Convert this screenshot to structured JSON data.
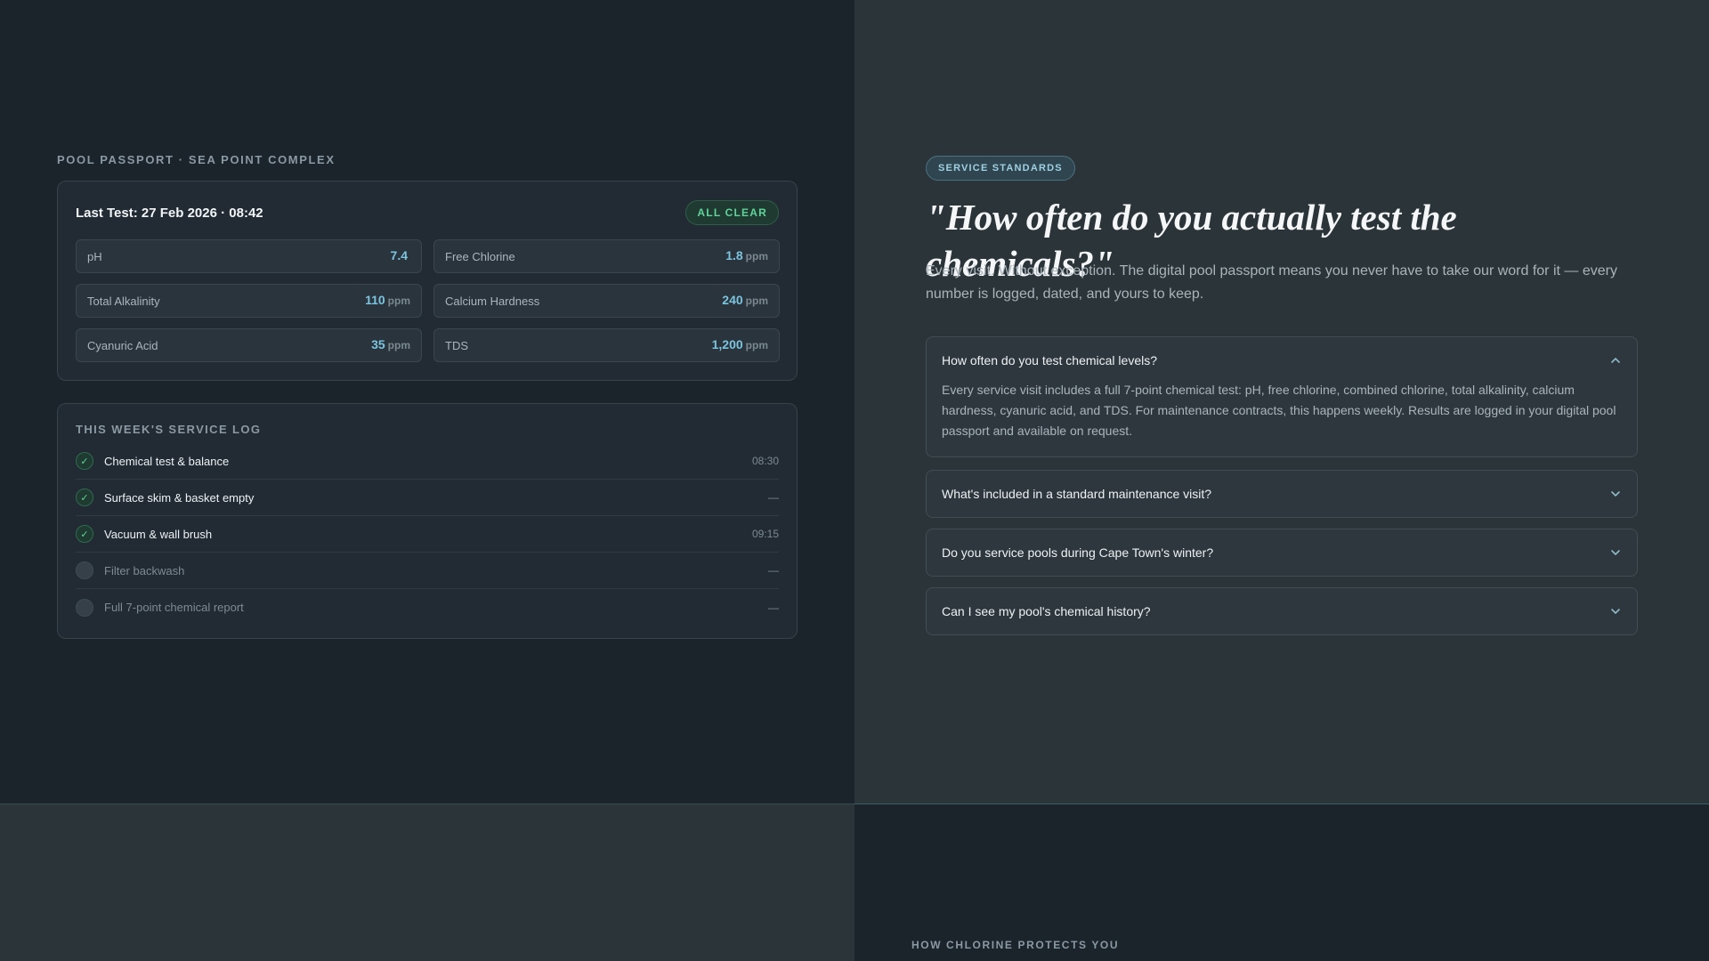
{
  "passport": {
    "eyebrow": "Pool Passport · Sea Point Complex",
    "last_test": "Last Test: 27 Feb 2026 · 08:42",
    "status_badge": "All Clear",
    "metrics": [
      {
        "name": "pH",
        "value": "7.4",
        "unit": ""
      },
      {
        "name": "Free Chlorine",
        "value": "1.8",
        "unit": "ppm"
      },
      {
        "name": "Total Alkalinity",
        "value": "110",
        "unit": "ppm"
      },
      {
        "name": "Calcium Hardness",
        "value": "240",
        "unit": "ppm"
      },
      {
        "name": "Cyanuric Acid",
        "value": "35",
        "unit": "ppm"
      },
      {
        "name": "TDS",
        "value": "1,200",
        "unit": "ppm"
      }
    ]
  },
  "service_log": {
    "title": "This Week's Service Log",
    "items": [
      {
        "label": "Chemical test & balance",
        "time": "08:30",
        "done": true,
        "check": "✓"
      },
      {
        "label": "Surface skim & basket empty",
        "time": "—",
        "done": true,
        "check": "✓"
      },
      {
        "label": "Vacuum & wall brush",
        "time": "09:15",
        "done": true,
        "check": "✓"
      },
      {
        "label": "Filter backwash",
        "time": "—",
        "done": false,
        "check": ""
      },
      {
        "label": "Full 7-point chemical report",
        "time": "—",
        "done": false,
        "check": ""
      }
    ]
  },
  "standards": {
    "tag": "Service Standards",
    "quote": "\"How often do you actually test the chemicals?\"",
    "lede": "Every visit. Without exception. The digital pool passport means you never have to take our word for it — every number is logged, dated, and yours to keep."
  },
  "faq": [
    {
      "question": "How often do you test chemical levels?",
      "answer": "Every service visit includes a full 7-point chemical test: pH, free chlorine, combined chlorine, total alkalinity, calcium hardness, cyanuric acid, and TDS. For maintenance contracts, this happens weekly. Results are logged in your digital pool passport and available on request.",
      "expanded": true
    },
    {
      "question": "What's included in a standard maintenance visit?",
      "answer": "",
      "expanded": false
    },
    {
      "question": "Do you service pools during Cape Town's winter?",
      "answer": "",
      "expanded": false
    },
    {
      "question": "Can I see my pool's chemical history?",
      "answer": "",
      "expanded": false
    }
  ],
  "next_section": {
    "eyebrow": "How Chlorine Protects You"
  },
  "colors": {
    "accent": "#7cc3de",
    "success": "#5fd39a",
    "panel_dark": "#1b232b",
    "panel_slate": "#2b3438"
  },
  "icons": {
    "check": "check-icon",
    "chevron_up": "chevron-up-icon",
    "chevron_down": "chevron-down-icon"
  }
}
